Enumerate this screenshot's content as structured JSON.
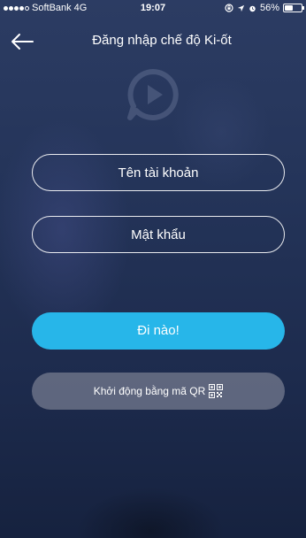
{
  "status_bar": {
    "carrier": "SoftBank",
    "network": "4G",
    "time": "19:07",
    "battery": "56%",
    "battery_level": 0.56,
    "signal_bars_filled": 4,
    "signal_bars_total": 5,
    "icons": [
      "signal-dots-icon",
      "screen-rotation-lock-icon",
      "location-arrow-icon",
      "alarm-icon",
      "battery-icon"
    ]
  },
  "nav": {
    "title": "Đăng nhập chế độ Ki-ốt",
    "back_icon": "arrow-left-icon"
  },
  "logo_icon": "chat-play-logo-icon",
  "form": {
    "username_placeholder": "Tên tài khoản",
    "password_placeholder": "Mật khẩu",
    "submit_label": "Đi nào!",
    "qr_label": "Khởi động bằng mã QR",
    "qr_icon": "qr-code-icon"
  },
  "colors": {
    "background_top": "#2c3c63",
    "background_bottom": "#16223f",
    "primary_button": "#27b6e9",
    "secondary_button": "#787e91",
    "text": "#ffffff"
  }
}
